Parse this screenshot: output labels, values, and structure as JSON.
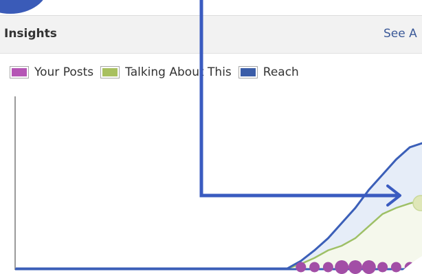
{
  "panel": {
    "title": "Insights",
    "see_all_label": "See A"
  },
  "legend": [
    {
      "label": "Your Posts",
      "color": "#b556b5"
    },
    {
      "label": "Talking About This",
      "color": "#a8c060"
    },
    {
      "label": "Reach",
      "color": "#3b5da8"
    }
  ],
  "colors": {
    "reach_line": "#3b5fb8",
    "reach_fill": "#e6edf8",
    "talking_line": "#9ec066",
    "talking_fill": "#f5f8ec",
    "posts_dot": "#a24ea6",
    "axis": "#9a9a9a",
    "annotation_arrow": "#3a5bc0"
  },
  "chart_data": {
    "type": "area",
    "series": [
      {
        "name": "Reach",
        "values": [
          0,
          0,
          0,
          0,
          0,
          0,
          0,
          0,
          0,
          0,
          0,
          0,
          0,
          0,
          0,
          0,
          0,
          0,
          0,
          0,
          0,
          5,
          12,
          20,
          30,
          40,
          52,
          62,
          72,
          80,
          83
        ]
      },
      {
        "name": "Talking About This",
        "values": [
          0,
          0,
          0,
          0,
          0,
          0,
          0,
          0,
          0,
          0,
          0,
          0,
          0,
          0,
          0,
          0,
          0,
          0,
          0,
          0,
          0,
          3,
          7,
          12,
          15,
          20,
          28,
          36,
          40,
          43,
          45
        ]
      },
      {
        "name": "Your Posts",
        "values": [
          null,
          null,
          null,
          null,
          null,
          null,
          null,
          null,
          null,
          null,
          null,
          null,
          null,
          null,
          null,
          null,
          null,
          null,
          null,
          null,
          null,
          1,
          1,
          1,
          2,
          2,
          2,
          1,
          1,
          1,
          1
        ]
      }
    ],
    "ylim": [
      0,
      100
    ],
    "grid": false,
    "legend_position": "top-left"
  }
}
